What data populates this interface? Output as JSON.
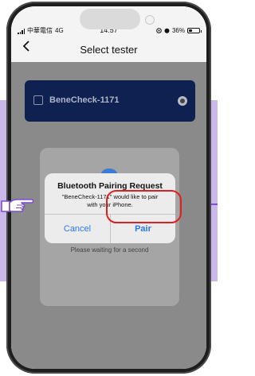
{
  "status_bar": {
    "carrier": "中華電信",
    "network": "4G",
    "time": "14:57",
    "battery_text": "36%",
    "battery_level": 0.36
  },
  "nav": {
    "back_icon": "chevron-left-icon",
    "title": "Select tester"
  },
  "device_list": [
    {
      "name": "BeneCheck-1171",
      "checked": false,
      "selected": true
    }
  ],
  "waiting_text": "Please waiting for a second",
  "alert": {
    "title": "Bluetooth Pairing Request",
    "message_line1": "\"BeneCheck-1171\" would like to pair",
    "message_line2": "with your iPhone.",
    "cancel_label": "Cancel",
    "pair_label": "Pair"
  },
  "colors": {
    "accent": "#2a78f0",
    "card": "#0e2150",
    "highlight": "#e02020",
    "annotation": "#7a4fd1",
    "background_band": "#c9b9ea"
  },
  "annotation": {
    "pointer_icon": "pointing-hand-icon"
  }
}
